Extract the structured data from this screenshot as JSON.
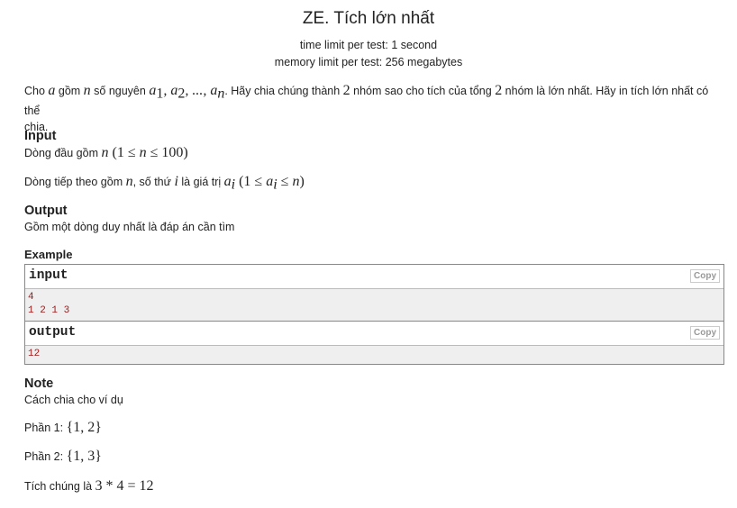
{
  "problem": {
    "title": "ZE. Tích lớn nhất",
    "time_limit": "time limit per test: 1 second",
    "memory_limit": "memory limit per test: 256 megabytes"
  },
  "statement": {
    "s1": "Cho ",
    "a": "a",
    "s2": " gồm ",
    "n": "n",
    "s3": " số nguyên ",
    "seq": "a",
    "sub1": "1",
    "seq2": ", a",
    "sub2": "2",
    "seq3": ", ..., a",
    "subn": "n",
    "s4": ". Hãy chia chúng thành ",
    "two1": "2",
    "s5": " nhóm sao cho tích của tổng ",
    "two2": "2",
    "s6": " nhóm là lớn nhất. Hãy in tích lớn nhất có thể",
    "s7": "chia."
  },
  "input_section": {
    "heading": "Input",
    "line1_text": "Dòng đầu gồm ",
    "line1_n": "n",
    "line1_math": " (1 ≤ ",
    "line1_n2": "n",
    "line1_math2": " ≤ 100)",
    "line2_text": "Dòng tiếp theo gồm ",
    "line2_n": "n",
    "line2_text2": ", số thứ ",
    "line2_i": "i",
    "line2_text3": " là giá trị ",
    "line2_ai": "a",
    "line2_sub": "i",
    "line2_math": " (1 ≤ ",
    "line2_ai2": "a",
    "line2_sub2": "i",
    "line2_math2": " ≤ ",
    "line2_n3": "n",
    "line2_math3": ")"
  },
  "output_section": {
    "heading": "Output",
    "text": "Gồm một dòng duy nhất là đáp án cần tìm"
  },
  "example": {
    "heading": "Example",
    "input_label": "input",
    "output_label": "output",
    "copy_label": "Copy",
    "input_lines": [
      "4",
      "1 2 1 3"
    ],
    "output_lines": [
      "12"
    ]
  },
  "note": {
    "heading": "Note",
    "line1": "Cách chia cho ví dụ",
    "part1_label": "Phần 1: ",
    "part1_set": "{1, 2}",
    "part2_label": "Phần 2: ",
    "part2_set": "{1, 3}",
    "product_label": "Tích chúng là ",
    "product_expr": "3 * 4 = 12"
  }
}
